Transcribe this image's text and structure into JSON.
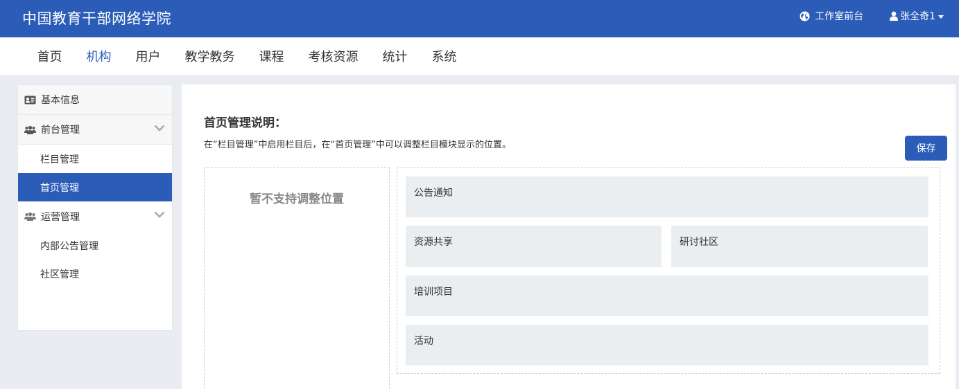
{
  "header": {
    "brand": "中国教育干部网络学院",
    "studio_link": "工作室前台",
    "user_name": "张全奇1"
  },
  "nav": {
    "items": [
      "首页",
      "机构",
      "用户",
      "教学教务",
      "课程",
      "考核资源",
      "统计",
      "系统"
    ],
    "active": "机构"
  },
  "sidebar": {
    "basic_info": "基本信息",
    "front_mgmt": "前台管理",
    "column_mgmt": "栏目管理",
    "home_mgmt": "首页管理",
    "ops_mgmt": "运营管理",
    "internal_notice_mgmt": "内部公告管理",
    "community_mgmt": "社区管理",
    "active": "首页管理"
  },
  "main": {
    "title": "首页管理说明：",
    "description": "在“栏目管理”中启用栏目后，在“首页管理”中可以调整栏目模块显示的位置。",
    "save_label": "保存",
    "unsupported_label": "暂不支持调整位置",
    "modules": {
      "notice": "公告通知",
      "resource": "资源共享",
      "discussion": "研讨社区",
      "training": "培训项目",
      "activity": "活动"
    }
  },
  "colors": {
    "primary": "#2a5cb8",
    "module_bg": "#ebeef1",
    "page_bg": "#e9edf1"
  }
}
